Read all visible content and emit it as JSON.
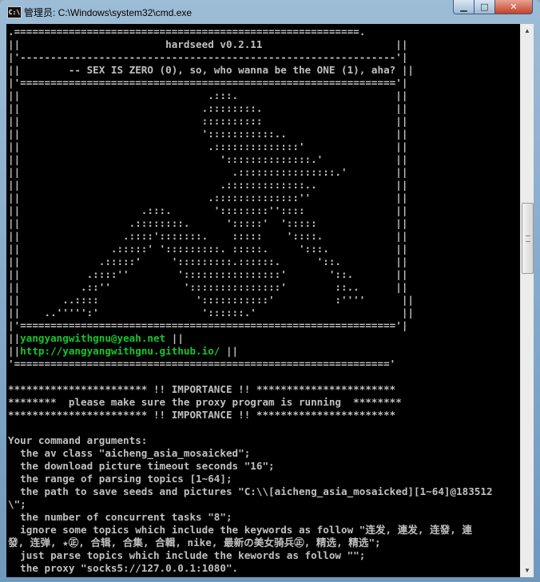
{
  "window": {
    "title": "管理员: C:\\Windows\\system32\\cmd.exe",
    "app_icon": "C:\\",
    "minimize_icon": "minimize-icon",
    "maximize_icon": "maximize-icon",
    "close_icon": "close-icon"
  },
  "console": {
    "banner_top": ".=========================================================.\n||                        hardseed v0.2.11                      ||\n|'--------------------------------------------------------------'|\n||        -- SEX IS ZERO (0), so, who wanna be the ONE (1), aha? ||\n|'=============================================================='|\n||                               .:::.                          ||\n||                              .::::::::.                      ||\n||                              ::::::::::                      ||\n||                              ':::::::::::..                  ||\n||                               .::::::::::::::'               ||\n||                                 '::::::::::::::.'            ||\n||                                   .::::::::::::::::.'        ||\n||                                 .:::::::::::::..             ||\n||                               .::::::::::::::''              ||\n||                    .:::.       '::::::::''::::               ||\n||                  .::::::::.      ':::::'  ':::::             ||\n||                 .::::':::::::.    :::::    '::::.            ||\n||               .:::::' ':::::::::. :::::.     ':::.           ||\n||             .:::::'     ':::::::::.::::::.      '::.         ||\n||           .::::''        '::::::::::::::::'       '::.       ||\n||          .::''            ':::::::::::::::'        ::..      ||\n||       ..::::                ':::::::::::'          :''''      ||\n||    ..''''':'                 '::::::.'                        ||\n|'=============================================================='|\n||",
    "email": "yangyangwithgnu@yeah.net",
    "url": "http://yangyangwithgnu.github.io/",
    "after_email": " ||\n||",
    "after_url": " ||\n'=============================================================='",
    "importance_block": "\n\n*********************** !! IMPORTANCE !! ***********************\n********  please make sure the proxy program is running  ********\n*********************** !! IMPORTANCE !! ***********************\n\n",
    "arguments": "Your command arguments:\n  the av class \"aicheng_asia_mosaicked\";\n  the download picture timeout seconds \"16\";\n  the range of parsing topics [1~64];\n  the path to save seeds and pictures \"C:\\\\[aicheng_asia_mosaicked][1~64]@183512\n\\\";\n  the number of concurrent tasks \"8\";\n  ignore some topics which include the keywords as follow \"连发, 連发, 连發, 連\n發, 连弹, ★㊣, 合辑, 合集, 合輯, nike, 最新の美女骑兵㊣, 精选, 精选\";\n  just parse topics which include the kewords as follow \"\";\n  the proxy \"socks5://127.0.0.1:1080\"."
  }
}
